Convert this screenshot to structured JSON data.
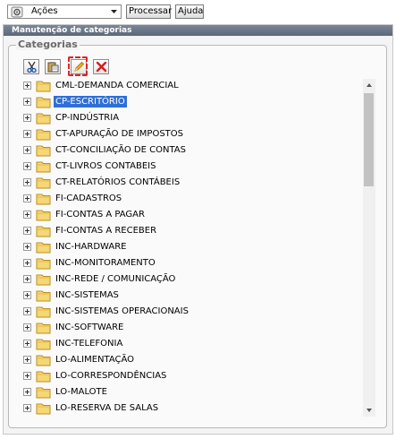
{
  "toolbar": {
    "actions_label": "Ações",
    "processar_label": "Processar",
    "ajuda_label": "Ajuda"
  },
  "panel": {
    "title": "Manutenção de categorias",
    "legend": "Categorias"
  },
  "category_toolbar": {
    "buttons": [
      "cut-icon",
      "paste-icon",
      "edit-icon",
      "delete-icon"
    ]
  },
  "tree": {
    "selected_index": 1,
    "items": [
      {
        "label": "CML-DEMANDA COMERCIAL"
      },
      {
        "label": "CP-ESCRITÓRIO"
      },
      {
        "label": "CP-INDÚSTRIA"
      },
      {
        "label": "CT-APURAÇÃO DE IMPOSTOS"
      },
      {
        "label": "CT-CONCILIAÇÃO DE CONTAS"
      },
      {
        "label": "CT-LIVROS CONTABEIS"
      },
      {
        "label": "CT-RELATÓRIOS CONTÁBEIS"
      },
      {
        "label": "FI-CADASTROS"
      },
      {
        "label": "FI-CONTAS A PAGAR"
      },
      {
        "label": "FI-CONTAS A RECEBER"
      },
      {
        "label": "INC-HARDWARE"
      },
      {
        "label": "INC-MONITORAMENTO"
      },
      {
        "label": "INC-REDE / COMUNICAÇÃO"
      },
      {
        "label": "INC-SISTEMAS"
      },
      {
        "label": "INC-SISTEMAS OPERACIONAIS"
      },
      {
        "label": "INC-SOFTWARE"
      },
      {
        "label": "INC-TELEFONIA"
      },
      {
        "label": "LO-ALIMENTAÇÃO"
      },
      {
        "label": "LO-CORRESPONDÊNCIAS"
      },
      {
        "label": "LO-MALOTE"
      },
      {
        "label": "LO-RESERVA DE SALAS"
      }
    ]
  },
  "colors": {
    "selection": "#2f6fd6",
    "highlight": "#e02424",
    "panel_title": "#5b6877"
  }
}
